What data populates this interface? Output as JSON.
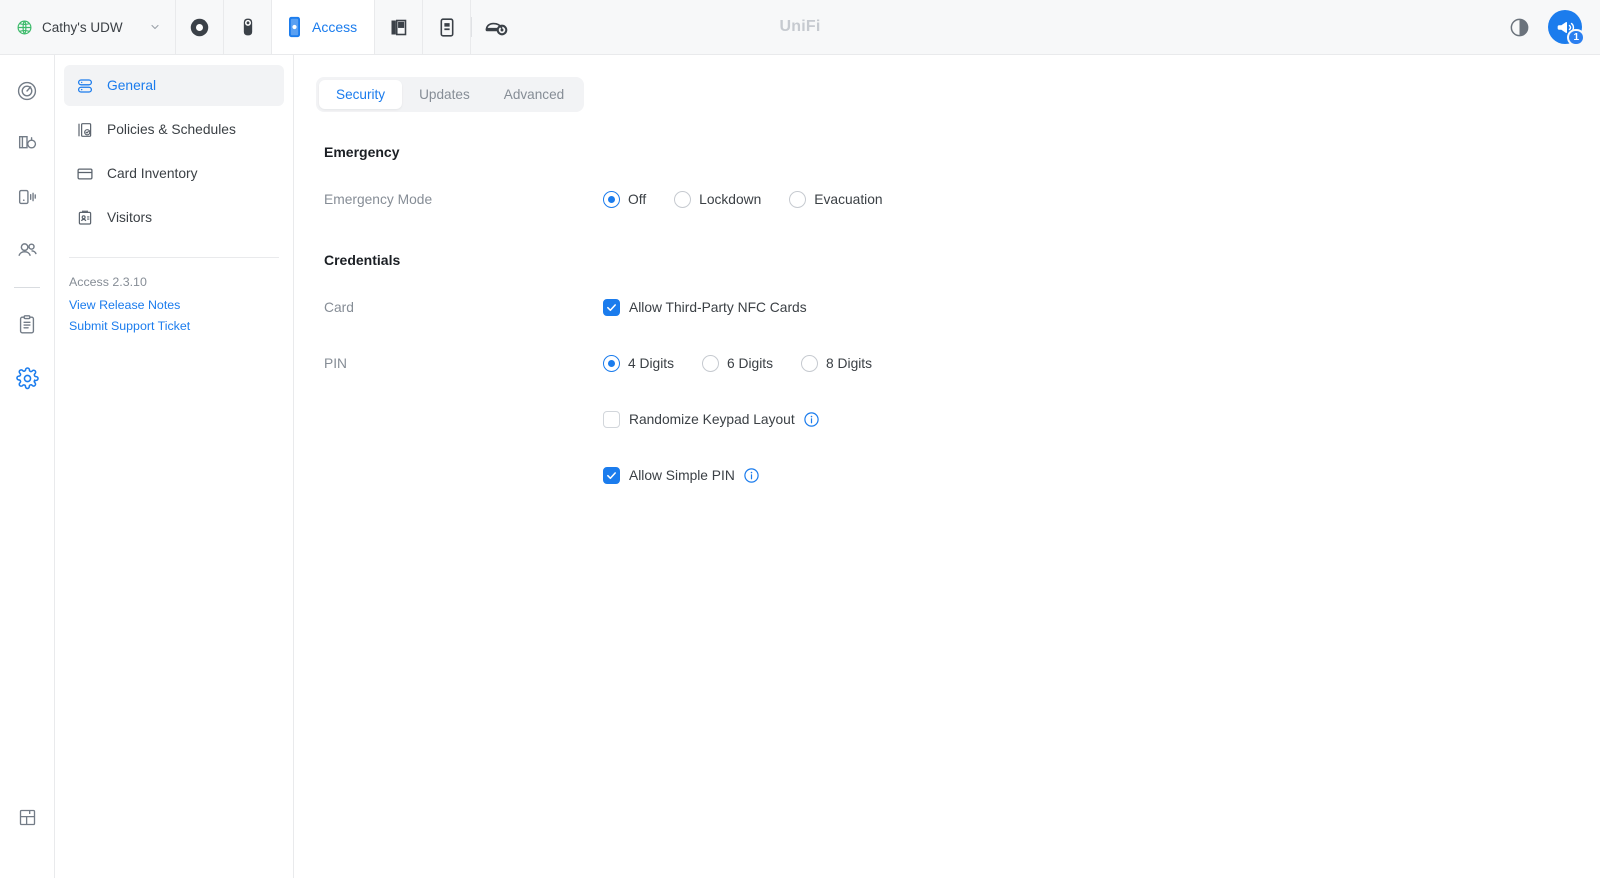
{
  "header": {
    "console_name": "Cathy's UDW",
    "globe_icon": "globe-icon",
    "chevron_icon": "chevron-down-icon",
    "brand": "UniFi",
    "active_app_label": "Access",
    "apps": [
      {
        "icon": "protect-icon",
        "name": "app-protect"
      },
      {
        "icon": "camera-icon",
        "name": "app-camera"
      },
      {
        "icon": "door-reader-icon",
        "name": "app-door-reader"
      },
      {
        "icon": "door-panel-icon",
        "name": "app-door-panel"
      },
      {
        "icon": "intercom-icon",
        "name": "app-intercom"
      },
      {
        "icon": "vehicle-settings-icon",
        "name": "app-vehicle-settings"
      }
    ],
    "theme_toggle_icon": "contrast-icon",
    "announcement_icon": "megaphone-icon",
    "announcement_badge": "1"
  },
  "rail": {
    "items": [
      {
        "icon": "dashboard-gauge-icon",
        "name": "rail-item-dashboard",
        "active": false
      },
      {
        "icon": "door-lock-icon",
        "name": "rail-item-doors",
        "active": false
      },
      {
        "icon": "device-reader-icon",
        "name": "rail-item-devices",
        "active": false
      },
      {
        "icon": "users-icon",
        "name": "rail-item-users",
        "active": false
      },
      {
        "icon": "clipboard-logs-icon",
        "name": "rail-item-logs",
        "active": false
      },
      {
        "icon": "settings-gear-icon",
        "name": "rail-item-settings",
        "active": true
      }
    ],
    "bottom_icon": "floorplan-icon"
  },
  "sidebar": {
    "items": [
      {
        "label": "General",
        "icon": "server-stack-icon",
        "active": true
      },
      {
        "label": "Policies & Schedules",
        "icon": "policy-door-icon",
        "active": false
      },
      {
        "label": "Card Inventory",
        "icon": "card-icon",
        "active": false
      },
      {
        "label": "Visitors",
        "icon": "visitor-badge-icon",
        "active": false
      }
    ],
    "version": "Access 2.3.10",
    "release_notes_link": "View Release Notes",
    "support_ticket_link": "Submit Support Ticket"
  },
  "main": {
    "tabs": [
      {
        "label": "Security",
        "active": true
      },
      {
        "label": "Updates",
        "active": false
      },
      {
        "label": "Advanced",
        "active": false
      }
    ],
    "emergency": {
      "section_title": "Emergency",
      "mode_label": "Emergency Mode",
      "options": [
        {
          "label": "Off",
          "selected": true
        },
        {
          "label": "Lockdown",
          "selected": false
        },
        {
          "label": "Evacuation",
          "selected": false
        }
      ]
    },
    "credentials": {
      "section_title": "Credentials",
      "card_label": "Card",
      "card_checkbox": {
        "label": "Allow Third-Party NFC Cards",
        "checked": true
      },
      "pin_label": "PIN",
      "pin_options": [
        {
          "label": "4 Digits",
          "selected": true
        },
        {
          "label": "6 Digits",
          "selected": false
        },
        {
          "label": "8 Digits",
          "selected": false
        }
      ],
      "randomize_keypad": {
        "label": "Randomize Keypad Layout",
        "checked": false,
        "info_icon": "info-icon"
      },
      "allow_simple_pin": {
        "label": "Allow Simple PIN",
        "checked": true,
        "info_icon": "info-icon"
      }
    }
  },
  "colors": {
    "accent": "#1b7ced",
    "text": "#3b4045",
    "muted": "#868d96",
    "panel": "#f7f8f9",
    "border": "#e9eaec",
    "globe_green": "#3dbb6b"
  }
}
